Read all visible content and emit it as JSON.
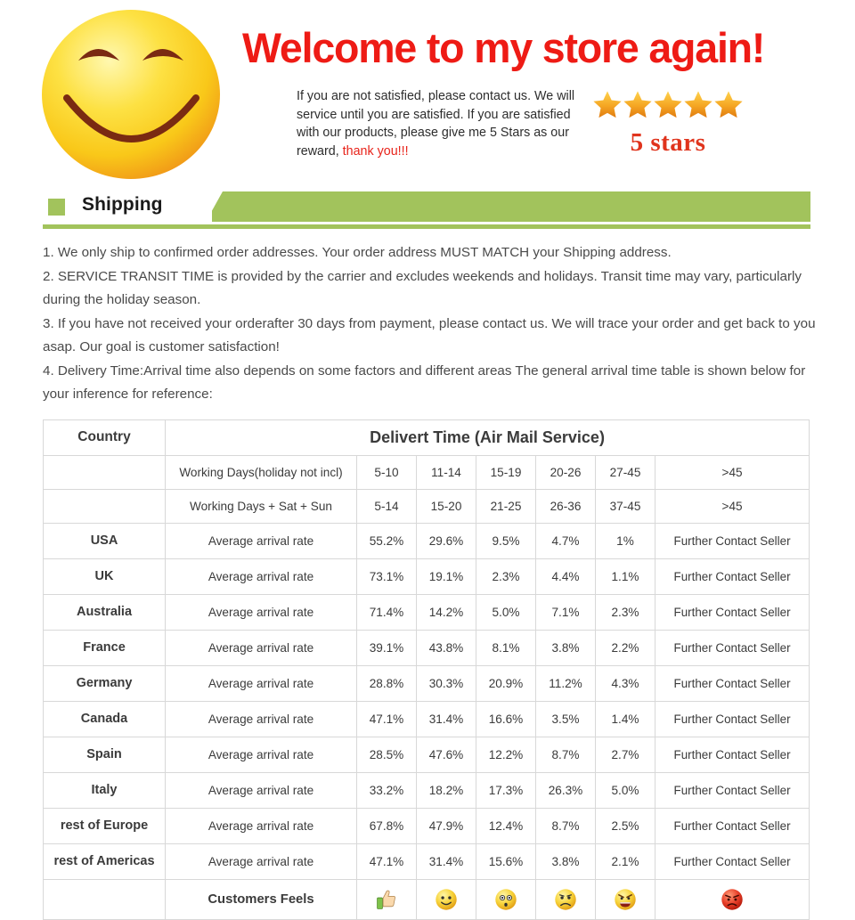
{
  "banner": {
    "headline": "Welcome to my store again!",
    "blurb_line1": "If you are not satisfied, please contact us. We",
    "blurb_line2": "will service until you are satisfied. If you are",
    "blurb_line3": "satisfied with our products, please give me 5",
    "blurb_line4": "Stars as our reward, ",
    "blurb_thanks": "thank you!!!",
    "stars_count": 5,
    "stars_label": "5 stars",
    "smiley_icon": "smiley-face-icon",
    "colors": {
      "headline_red": "#ee1b15",
      "thanks_red": "#e8231a",
      "star_gold": "#f5a623",
      "stars_label_red": "#e0341d",
      "smiley_yellow": "#fbd51f",
      "smiley_orange": "#f0901c"
    }
  },
  "section": {
    "title": "Shipping",
    "accent_green": "#a2c35c",
    "square_icon": "green-square-icon"
  },
  "policy": {
    "items": [
      "1. We only ship to confirmed order addresses. Your order address MUST MATCH your Shipping address.",
      "2. SERVICE TRANSIT TIME is provided by the carrier and excludes weekends and holidays. Transit time may vary, particularly during the holiday season.",
      "3. If you have not received your orderafter 30 days from payment, please contact us. We will trace your order and get back to you asap. Our goal is customer satisfaction!",
      "4. Delivery Time:Arrival time also depends on some factors and different areas The general arrival time table is shown below for your inference for reference:"
    ]
  },
  "table": {
    "header": {
      "country": "Country",
      "delivery": "Delivert Time (Air Mail Service)"
    },
    "working_days_rows": [
      {
        "label": "Working Days(holiday not incl)",
        "ranges": [
          "5-10",
          "11-14",
          "15-19",
          "20-26",
          "27-45"
        ],
        "last": ">45"
      },
      {
        "label": "Working Days + Sat + Sun",
        "ranges": [
          "5-14",
          "15-20",
          "21-25",
          "26-36",
          "37-45"
        ],
        "last": ">45"
      }
    ],
    "rate_label": "Average arrival rate",
    "contact_label": "Further Contact Seller",
    "rows": [
      {
        "country": "USA",
        "values": [
          "55.2%",
          "29.6%",
          "9.5%",
          "4.7%",
          "1%"
        ]
      },
      {
        "country": "UK",
        "values": [
          "73.1%",
          "19.1%",
          "2.3%",
          "4.4%",
          "1.1%"
        ]
      },
      {
        "country": "Australia",
        "values": [
          "71.4%",
          "14.2%",
          "5.0%",
          "7.1%",
          "2.3%"
        ]
      },
      {
        "country": "France",
        "values": [
          "39.1%",
          "43.8%",
          "8.1%",
          "3.8%",
          "2.2%"
        ]
      },
      {
        "country": "Germany",
        "values": [
          "28.8%",
          "30.3%",
          "20.9%",
          "11.2%",
          "4.3%"
        ]
      },
      {
        "country": "Canada",
        "values": [
          "47.1%",
          "31.4%",
          "16.6%",
          "3.5%",
          "1.4%"
        ]
      },
      {
        "country": "Spain",
        "values": [
          "28.5%",
          "47.6%",
          "12.2%",
          "8.7%",
          "2.7%"
        ]
      },
      {
        "country": "Italy",
        "values": [
          "33.2%",
          "18.2%",
          "17.3%",
          "26.3%",
          "5.0%"
        ]
      },
      {
        "country": "rest of Europe",
        "values": [
          "67.8%",
          "47.9%",
          "12.4%",
          "8.7%",
          "2.5%"
        ]
      },
      {
        "country": "rest of Americas",
        "values": [
          "47.1%",
          "31.4%",
          "15.6%",
          "3.8%",
          "2.1%"
        ]
      }
    ],
    "feels_row": {
      "label": "Customers Feels",
      "icons": [
        "thumbs-up-icon",
        "smiling-face-icon",
        "surprised-face-icon",
        "sad-face-icon",
        "angry-face-icon",
        "red-angry-face-icon"
      ]
    }
  }
}
